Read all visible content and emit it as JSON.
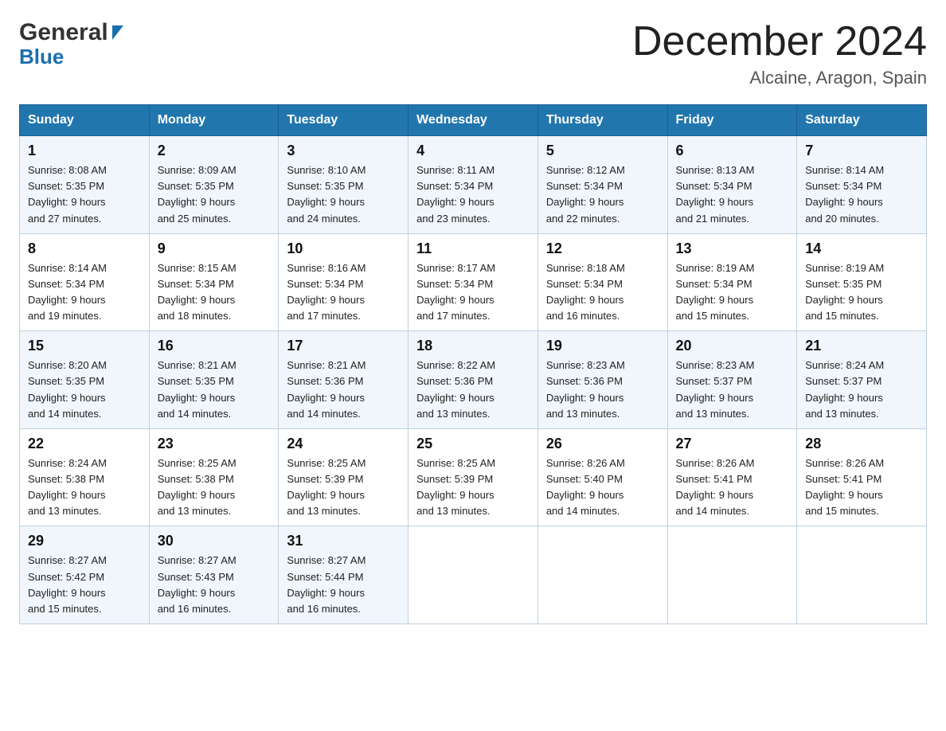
{
  "header": {
    "month_title": "December 2024",
    "location": "Alcaine, Aragon, Spain",
    "logo_general": "General",
    "logo_blue": "Blue"
  },
  "columns": [
    "Sunday",
    "Monday",
    "Tuesday",
    "Wednesday",
    "Thursday",
    "Friday",
    "Saturday"
  ],
  "weeks": [
    [
      {
        "day": "1",
        "sunrise": "8:08 AM",
        "sunset": "5:35 PM",
        "daylight": "9 hours and 27 minutes."
      },
      {
        "day": "2",
        "sunrise": "8:09 AM",
        "sunset": "5:35 PM",
        "daylight": "9 hours and 25 minutes."
      },
      {
        "day": "3",
        "sunrise": "8:10 AM",
        "sunset": "5:35 PM",
        "daylight": "9 hours and 24 minutes."
      },
      {
        "day": "4",
        "sunrise": "8:11 AM",
        "sunset": "5:34 PM",
        "daylight": "9 hours and 23 minutes."
      },
      {
        "day": "5",
        "sunrise": "8:12 AM",
        "sunset": "5:34 PM",
        "daylight": "9 hours and 22 minutes."
      },
      {
        "day": "6",
        "sunrise": "8:13 AM",
        "sunset": "5:34 PM",
        "daylight": "9 hours and 21 minutes."
      },
      {
        "day": "7",
        "sunrise": "8:14 AM",
        "sunset": "5:34 PM",
        "daylight": "9 hours and 20 minutes."
      }
    ],
    [
      {
        "day": "8",
        "sunrise": "8:14 AM",
        "sunset": "5:34 PM",
        "daylight": "9 hours and 19 minutes."
      },
      {
        "day": "9",
        "sunrise": "8:15 AM",
        "sunset": "5:34 PM",
        "daylight": "9 hours and 18 minutes."
      },
      {
        "day": "10",
        "sunrise": "8:16 AM",
        "sunset": "5:34 PM",
        "daylight": "9 hours and 17 minutes."
      },
      {
        "day": "11",
        "sunrise": "8:17 AM",
        "sunset": "5:34 PM",
        "daylight": "9 hours and 17 minutes."
      },
      {
        "day": "12",
        "sunrise": "8:18 AM",
        "sunset": "5:34 PM",
        "daylight": "9 hours and 16 minutes."
      },
      {
        "day": "13",
        "sunrise": "8:19 AM",
        "sunset": "5:34 PM",
        "daylight": "9 hours and 15 minutes."
      },
      {
        "day": "14",
        "sunrise": "8:19 AM",
        "sunset": "5:35 PM",
        "daylight": "9 hours and 15 minutes."
      }
    ],
    [
      {
        "day": "15",
        "sunrise": "8:20 AM",
        "sunset": "5:35 PM",
        "daylight": "9 hours and 14 minutes."
      },
      {
        "day": "16",
        "sunrise": "8:21 AM",
        "sunset": "5:35 PM",
        "daylight": "9 hours and 14 minutes."
      },
      {
        "day": "17",
        "sunrise": "8:21 AM",
        "sunset": "5:36 PM",
        "daylight": "9 hours and 14 minutes."
      },
      {
        "day": "18",
        "sunrise": "8:22 AM",
        "sunset": "5:36 PM",
        "daylight": "9 hours and 13 minutes."
      },
      {
        "day": "19",
        "sunrise": "8:23 AM",
        "sunset": "5:36 PM",
        "daylight": "9 hours and 13 minutes."
      },
      {
        "day": "20",
        "sunrise": "8:23 AM",
        "sunset": "5:37 PM",
        "daylight": "9 hours and 13 minutes."
      },
      {
        "day": "21",
        "sunrise": "8:24 AM",
        "sunset": "5:37 PM",
        "daylight": "9 hours and 13 minutes."
      }
    ],
    [
      {
        "day": "22",
        "sunrise": "8:24 AM",
        "sunset": "5:38 PM",
        "daylight": "9 hours and 13 minutes."
      },
      {
        "day": "23",
        "sunrise": "8:25 AM",
        "sunset": "5:38 PM",
        "daylight": "9 hours and 13 minutes."
      },
      {
        "day": "24",
        "sunrise": "8:25 AM",
        "sunset": "5:39 PM",
        "daylight": "9 hours and 13 minutes."
      },
      {
        "day": "25",
        "sunrise": "8:25 AM",
        "sunset": "5:39 PM",
        "daylight": "9 hours and 13 minutes."
      },
      {
        "day": "26",
        "sunrise": "8:26 AM",
        "sunset": "5:40 PM",
        "daylight": "9 hours and 14 minutes."
      },
      {
        "day": "27",
        "sunrise": "8:26 AM",
        "sunset": "5:41 PM",
        "daylight": "9 hours and 14 minutes."
      },
      {
        "day": "28",
        "sunrise": "8:26 AM",
        "sunset": "5:41 PM",
        "daylight": "9 hours and 15 minutes."
      }
    ],
    [
      {
        "day": "29",
        "sunrise": "8:27 AM",
        "sunset": "5:42 PM",
        "daylight": "9 hours and 15 minutes."
      },
      {
        "day": "30",
        "sunrise": "8:27 AM",
        "sunset": "5:43 PM",
        "daylight": "9 hours and 16 minutes."
      },
      {
        "day": "31",
        "sunrise": "8:27 AM",
        "sunset": "5:44 PM",
        "daylight": "9 hours and 16 minutes."
      },
      null,
      null,
      null,
      null
    ]
  ],
  "labels": {
    "sunrise": "Sunrise:",
    "sunset": "Sunset:",
    "daylight": "Daylight:"
  }
}
